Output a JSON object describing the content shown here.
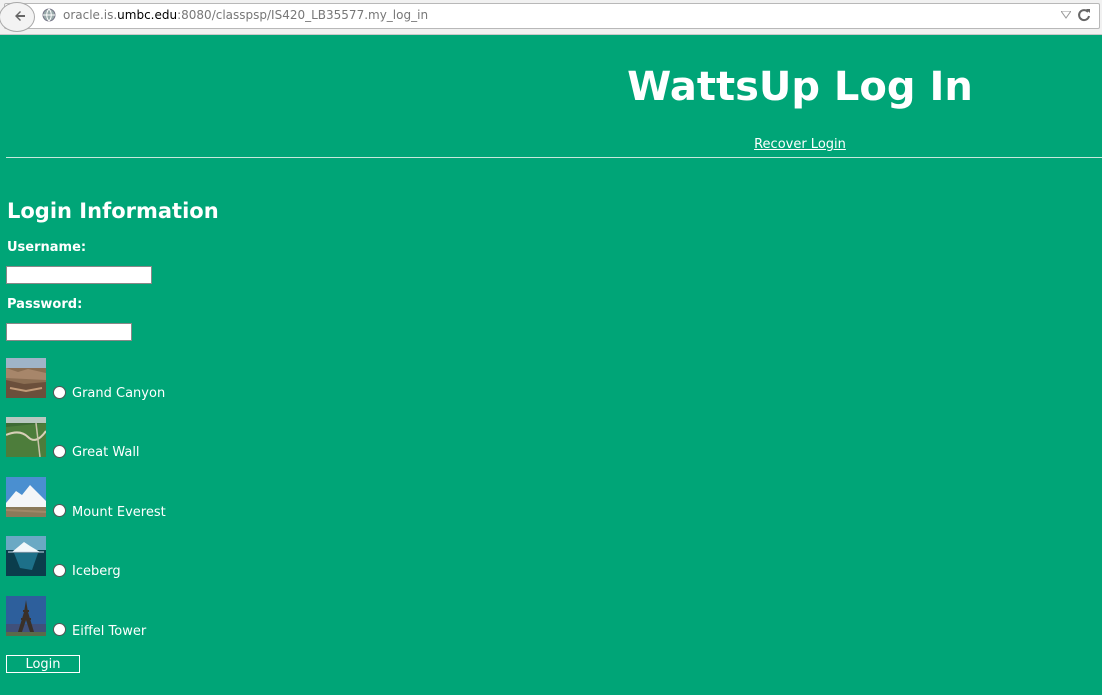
{
  "browser": {
    "url_prefix": "oracle.is.",
    "url_host": "umbc.edu",
    "url_rest": ":8080/classpsp/IS420_LB35577.my_log_in"
  },
  "header": {
    "title": "WattsUp Log In",
    "recover_link": "Recover Login"
  },
  "form": {
    "section_title": "Login Information",
    "username_label": "Username:",
    "username_value": "",
    "password_label": "Password:",
    "password_value": "",
    "options": [
      {
        "label": "Grand Canyon",
        "thumb": "grand-canyon-thumbnail"
      },
      {
        "label": "Great Wall",
        "thumb": "great-wall-thumbnail"
      },
      {
        "label": "Mount Everest",
        "thumb": "mount-everest-thumbnail"
      },
      {
        "label": "Iceberg",
        "thumb": "iceberg-thumbnail"
      },
      {
        "label": "Eiffel Tower",
        "thumb": "eiffel-tower-thumbnail"
      }
    ],
    "login_button": "Login"
  },
  "colors": {
    "page_bg": "#00a577",
    "text": "#ffffff"
  }
}
